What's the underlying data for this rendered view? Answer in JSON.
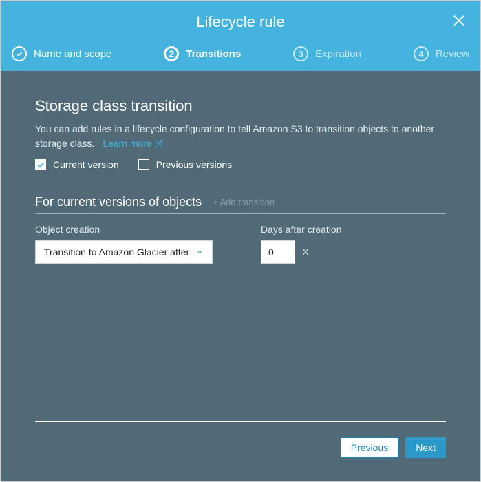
{
  "modal": {
    "title": "Lifecycle rule"
  },
  "steps": [
    {
      "num": "1",
      "label": "Name and scope",
      "state": "done"
    },
    {
      "num": "2",
      "label": "Transitions",
      "state": "active"
    },
    {
      "num": "3",
      "label": "Expiration",
      "state": "pending"
    },
    {
      "num": "4",
      "label": "Review",
      "state": "pending"
    }
  ],
  "body": {
    "heading": "Storage class transition",
    "description": "You can add rules in a lifecycle configuration to tell Amazon S3 to transition objects to another storage class.",
    "learn_more": "Learn more",
    "checkboxes": {
      "current": {
        "label": "Current version",
        "checked": true
      },
      "previous": {
        "label": "Previous versions",
        "checked": false
      }
    },
    "section": {
      "title": "For current versions of objects",
      "add_label": "+ Add transition"
    },
    "fields": {
      "object_creation_label": "Object creation",
      "object_creation_value": "Transition to Amazon Glacier after",
      "days_after_label": "Days after creation",
      "days_after_value": "0",
      "remove_label": "X"
    }
  },
  "footer": {
    "previous": "Previous",
    "next": "Next"
  }
}
